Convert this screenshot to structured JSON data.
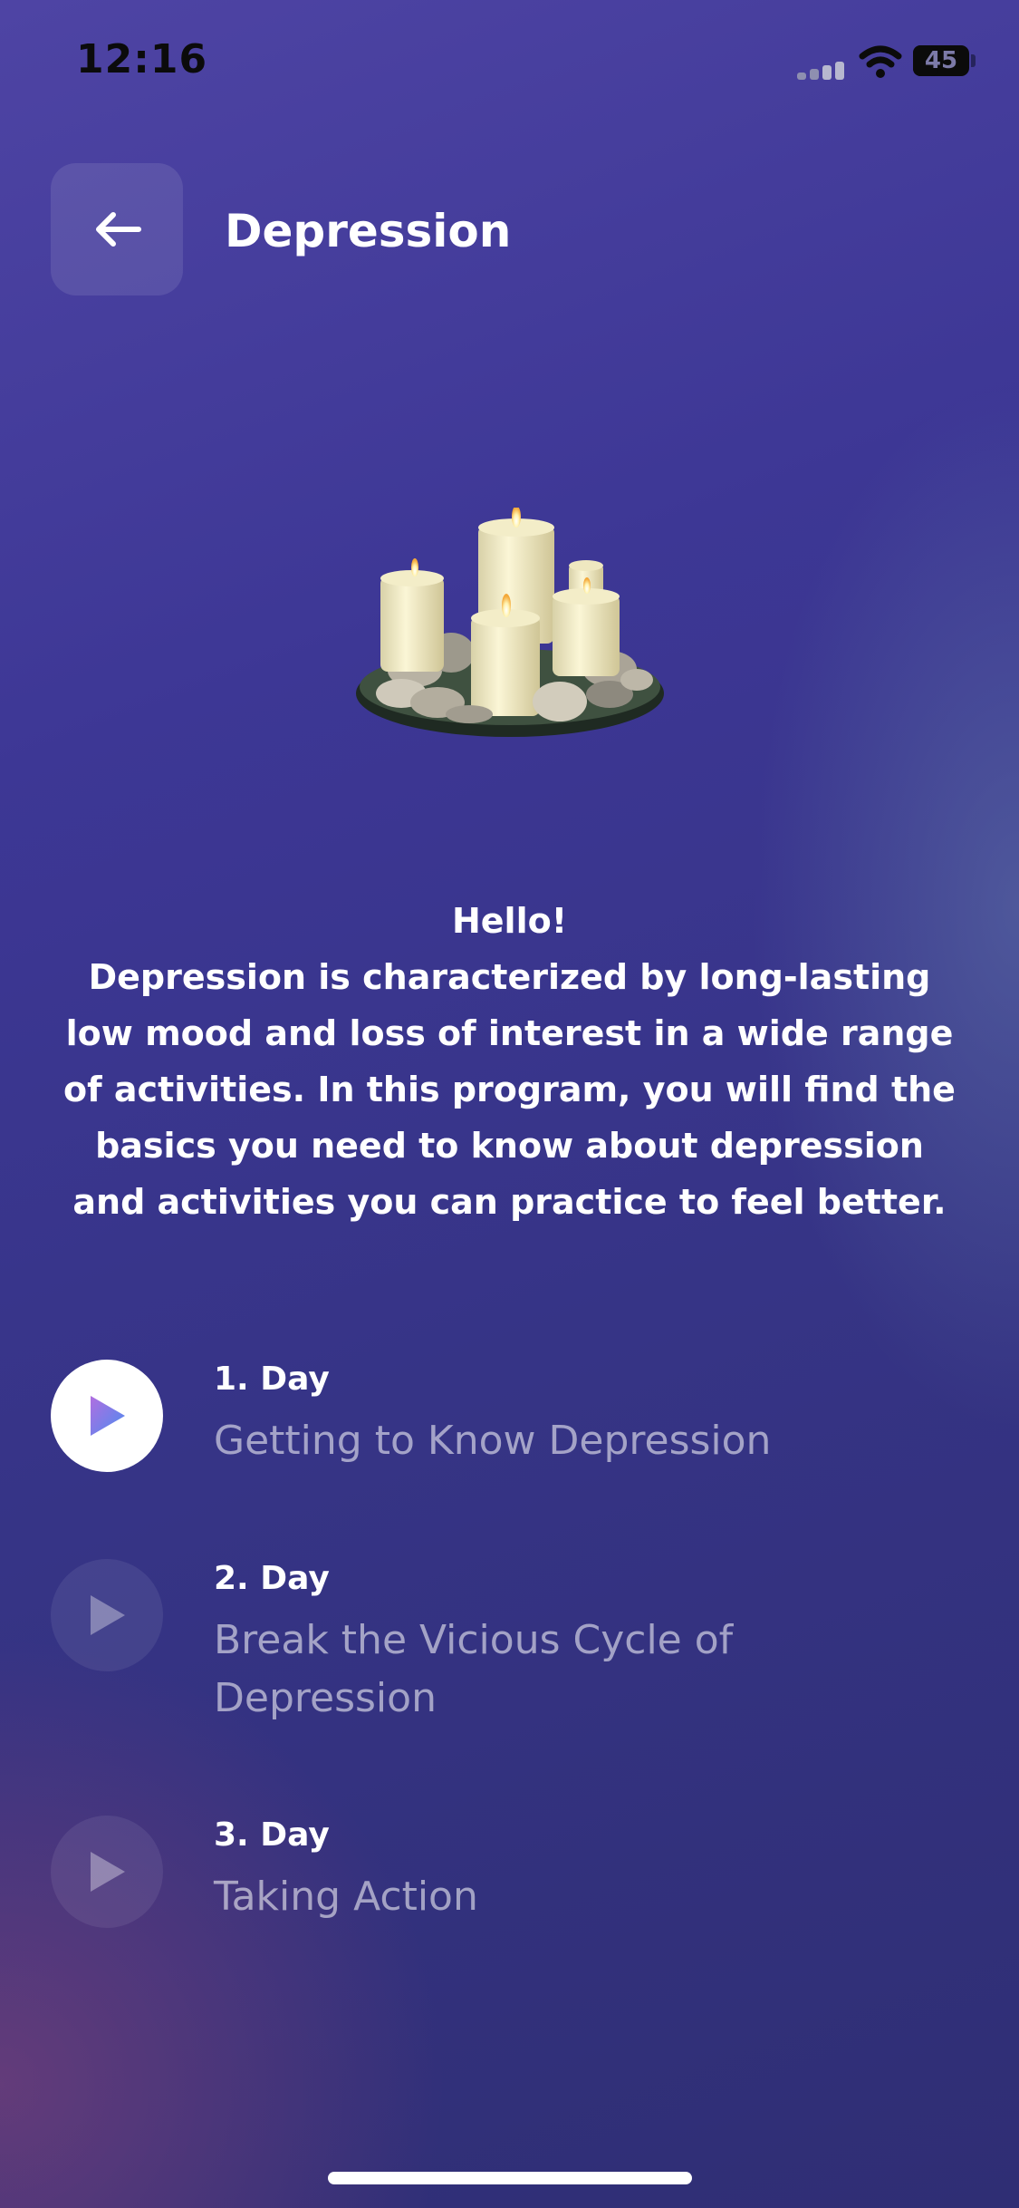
{
  "status_bar": {
    "time": "12:16",
    "battery_percent": "45",
    "battery_level": 0.45
  },
  "header": {
    "back_icon": "arrow-left-icon",
    "title": "Depression"
  },
  "illustration": {
    "icon": "candles-on-stones-image"
  },
  "intro": {
    "greeting": "Hello!",
    "description": "Depression is characterized by long-lasting low mood and loss of interest in a wide range of activities. In this program, you will find the basics you need to know about depression and activities you can practice to feel better."
  },
  "days": [
    {
      "label": "1. Day",
      "title": "Getting to Know Depression",
      "state": "active",
      "icon": "play-icon"
    },
    {
      "label": "2. Day",
      "title": "Break the Vicious Cycle of Depression",
      "state": "locked",
      "icon": "play-icon"
    },
    {
      "label": "3. Day",
      "title": "Taking Action",
      "state": "locked",
      "icon": "play-icon"
    }
  ],
  "colors": {
    "background_top": "#4e44a4",
    "background_bottom": "#2f2e74",
    "play_gradient_start": "#b16ee0",
    "play_gradient_end": "#4b8cf0"
  }
}
